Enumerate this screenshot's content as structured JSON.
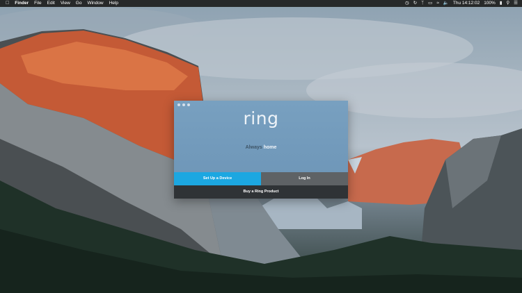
{
  "menubar": {
    "apple_icon": "apple-icon",
    "items": [
      "Finder",
      "File",
      "Edit",
      "View",
      "Go",
      "Window",
      "Help"
    ],
    "clock": "Thu 14:12:02",
    "battery": "100%",
    "icons": [
      "time-machine-icon",
      "sync-icon",
      "bluetooth-icon",
      "airplay-icon",
      "wifi-icon",
      "volume-icon",
      "battery-icon",
      "search-icon",
      "notifications-icon"
    ]
  },
  "ring_window": {
    "logo": "ring",
    "tagline_part1": "Always",
    "tagline_part2": "home",
    "setup_button": "Set Up a Device",
    "login_button": "Log In",
    "buy_button": "Buy a Ring Product",
    "colors": {
      "background": "#729ABB",
      "setup": "#1CA7E1",
      "login": "#5E6265",
      "buy": "#2F3336"
    }
  }
}
